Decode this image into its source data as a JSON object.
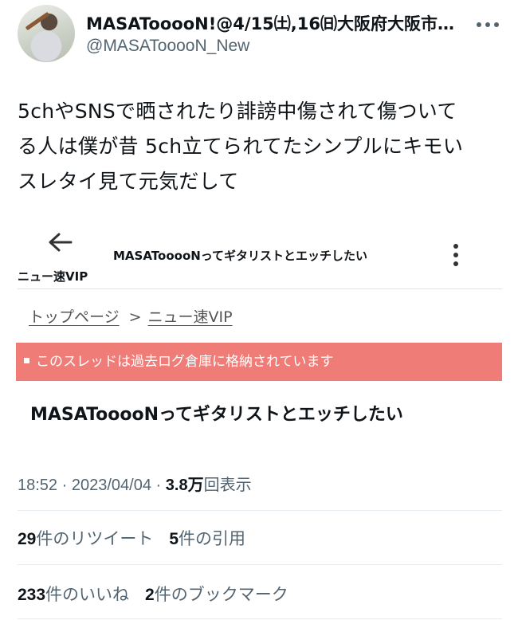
{
  "author": {
    "display_name": "MASATooooN!@4/15㈯,16㈰大阪府大阪市…",
    "handle": "@MASATooooN_New"
  },
  "tweet": {
    "lines": [
      "5chやSNSで晒されたり誹謗中傷されて傷ついて",
      "る人は僕が昔 5ch立てられてたシンプルにキモい",
      "スレタイ見て元気だして"
    ]
  },
  "embedded_screenshot": {
    "header_title": "MASATooooNってギタリストとエッチしたい",
    "board_name": "ニュー速VIP",
    "breadcrumb": [
      "トップページ",
      "ニュー速VIP"
    ],
    "breadcrumb_separator": ">",
    "archive_notice": "このスレッドは過去ログ倉庫に格納されています",
    "thread_title": "MASATooooNってギタリストとエッチしたい"
  },
  "meta": {
    "time": "18:52",
    "date": "2023/04/04",
    "views_value": "3.8万",
    "views_label": "回表示",
    "dot": "·"
  },
  "stats": {
    "retweets_count": "29",
    "retweets_label": "件のリツイート",
    "quotes_count": "5",
    "quotes_label": "件の引用",
    "likes_count": "233",
    "likes_label": "件のいいね",
    "bookmarks_count": "2",
    "bookmarks_label": "件のブックマーク"
  },
  "icons": {
    "more": "more-horizontal-icon",
    "back": "arrow-left-icon",
    "kebab": "more-vertical-icon"
  },
  "colors": {
    "notice_bg": "#f07c78",
    "secondary_text": "#536471"
  }
}
